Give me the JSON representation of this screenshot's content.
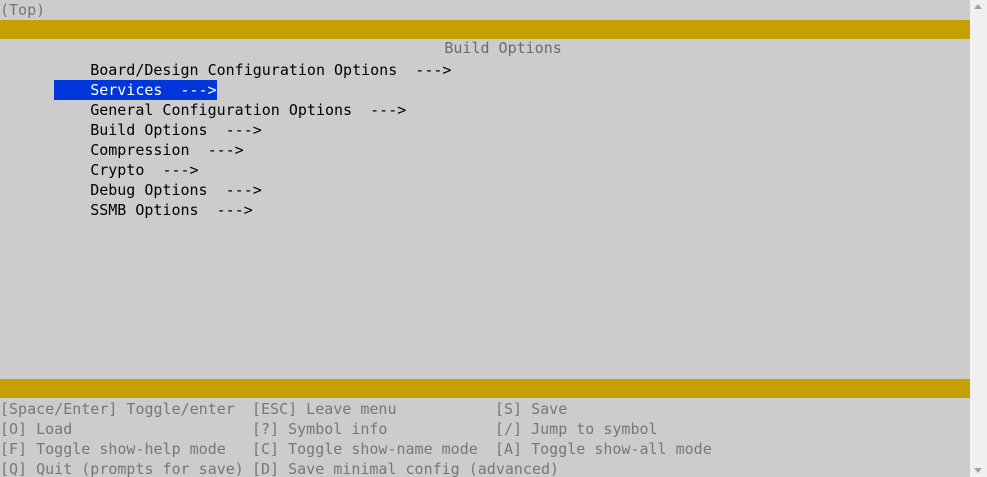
{
  "path": "(Top)",
  "title": "Build Options",
  "menu": {
    "items": [
      {
        "label": "Board/Design Configuration Options",
        "arrow": "--->",
        "selected": false
      },
      {
        "label": "Services",
        "arrow": "--->",
        "selected": true
      },
      {
        "label": "General Configuration Options",
        "arrow": "--->",
        "selected": false
      },
      {
        "label": "Build Options",
        "arrow": "--->",
        "selected": false
      },
      {
        "label": "Compression",
        "arrow": "--->",
        "selected": false
      },
      {
        "label": "Crypto",
        "arrow": "--->",
        "selected": false
      },
      {
        "label": "Debug Options",
        "arrow": "--->",
        "selected": false
      },
      {
        "label": "SSMB Options",
        "arrow": "--->",
        "selected": false
      }
    ]
  },
  "help": {
    "rows": [
      [
        "[Space/Enter] Toggle/enter",
        "[ESC] Leave menu",
        "[S] Save"
      ],
      [
        "[O] Load",
        "[?] Symbol info",
        "[/] Jump to symbol"
      ],
      [
        "[F] Toggle show-help mode",
        "[C] Toggle show-name mode",
        "[A] Toggle show-all mode"
      ],
      [
        "[Q] Quit (prompts for save)",
        "[D] Save minimal config (advanced)",
        ""
      ]
    ]
  },
  "colors": {
    "background": "#cccccc",
    "bar": "#c4a000",
    "selection": "#0037da",
    "dim_text": "#777777"
  },
  "icons": {
    "scroll_up": "chevron-up-icon",
    "scroll_down": "chevron-down-icon"
  }
}
